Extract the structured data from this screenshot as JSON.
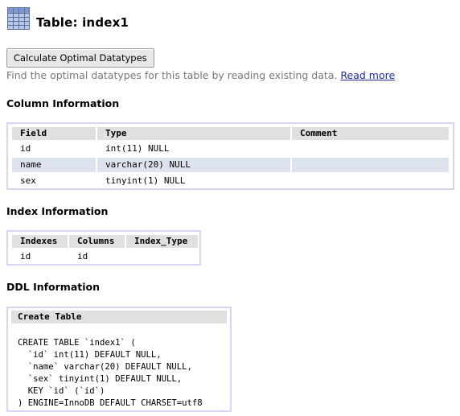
{
  "header": {
    "icon": "table-grid-icon",
    "title": "Table: index1"
  },
  "toolbar": {
    "calc_label": "Calculate Optimal Datatypes",
    "hint_text": "Find the optimal datatypes for this table by reading existing data.",
    "read_more": "Read more"
  },
  "columns": {
    "title": "Column Information",
    "headers": [
      "Field",
      "Type",
      "Comment"
    ],
    "rows": [
      [
        "id",
        "int(11) NULL",
        ""
      ],
      [
        "name",
        "varchar(20) NULL",
        ""
      ],
      [
        "sex",
        "tinyint(1) NULL",
        ""
      ]
    ]
  },
  "indexes": {
    "title": "Index Information",
    "headers": [
      "Indexes",
      "Columns",
      "Index_Type"
    ],
    "rows": [
      [
        "id",
        "id",
        ""
      ]
    ]
  },
  "ddl": {
    "title": "DDL Information",
    "header": "Create Table",
    "statement": "CREATE TABLE `index1` (\n  `id` int(11) DEFAULT NULL,\n  `name` varchar(20) DEFAULT NULL,\n  `sex` tinyint(1) DEFAULT NULL,\n  KEY `id` (`id`)\n) ENGINE=InnoDB DEFAULT CHARSET=utf8"
  },
  "colors": {
    "box_border": "#dcd2f0",
    "header_bg": "#e0e0e0",
    "row_highlight": "#dde2ef",
    "link": "#1e2b9a"
  }
}
